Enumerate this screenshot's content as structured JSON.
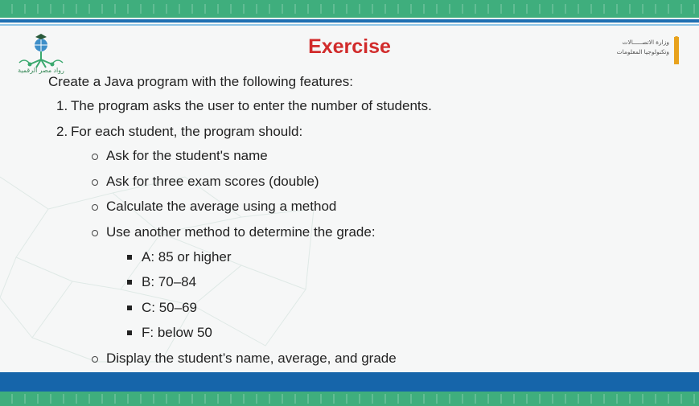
{
  "header": {
    "title": "Exercise",
    "left_logo_text": "رواد مصر الرقمية",
    "right_logo_line1": "وزارة الاتصـــــالات",
    "right_logo_line2": "وتكنولوجيا المعلومات"
  },
  "content": {
    "intro": "Create a Java program with the following features:",
    "steps": [
      {
        "num": "1.",
        "text": "The program asks the user to enter the number of students."
      },
      {
        "num": "2.",
        "text": "For each student, the program should:"
      }
    ],
    "sub_items": [
      "Ask for the student's name",
      "Ask for three exam scores (double)",
      "Calculate the average using a method",
      "Use another method to determine the grade:"
    ],
    "grades": [
      "A: 85 or higher",
      "B: 70–84",
      "C: 50–69",
      "F: below 50"
    ],
    "last_item": "Display the student’s name, average, and grade"
  },
  "colors": {
    "title": "#d12b2b",
    "green_band": "#3fae7d",
    "blue_band": "#1665aa"
  }
}
